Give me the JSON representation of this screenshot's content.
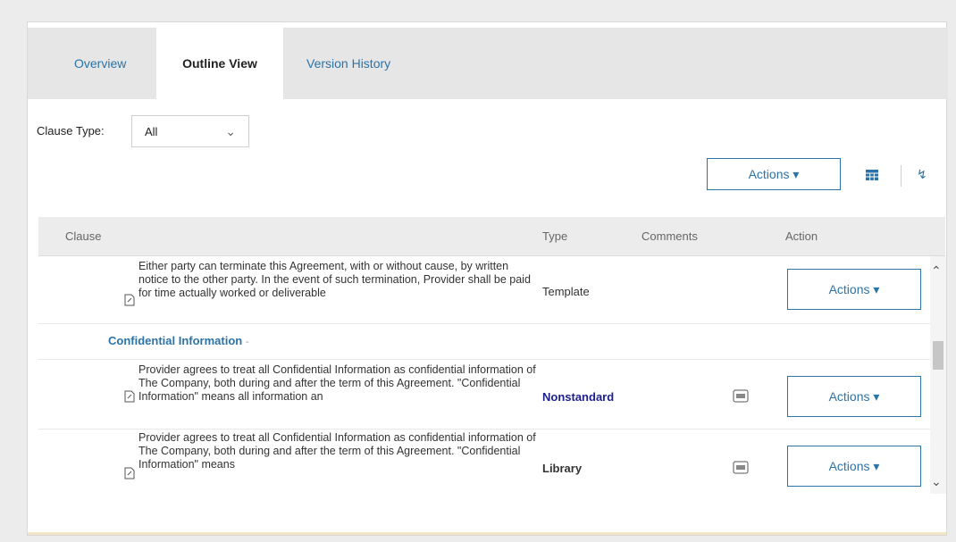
{
  "tabs": [
    {
      "label": "Overview",
      "active": false
    },
    {
      "label": "Outline View",
      "active": true
    },
    {
      "label": "Version History",
      "active": false
    }
  ],
  "filter": {
    "label": "Clause Type:",
    "value": "All",
    "icon": "chevron-down-icon"
  },
  "toolbar": {
    "actions_label": "Actions ▾",
    "grid_icon": "table-grid-icon",
    "expand_icon": "double-chevron-down-icon"
  },
  "table": {
    "headers": {
      "clause": "Clause",
      "type": "Type",
      "comments": "Comments",
      "action": "Action"
    },
    "rows": [
      {
        "text": "Either party can terminate this Agreement, with or without cause, by written notice to the other party. In the event of such termination, Provider shall be paid for time actually worked or deliverable",
        "type": "Template",
        "has_comment": false,
        "action": "Actions ▾"
      },
      {
        "text": "Provider agrees to treat all Confidential Information as confidential information of The Company, both during and after the term of this Agreement. \"Confidential Information\" means all information an",
        "type": "Nonstandard",
        "has_comment": true,
        "action": "Actions ▾"
      },
      {
        "text": "Provider agrees to treat all Confidential Information as confidential information of The Company, both during and after the term of this Agreement. \"Confidential Information\" means",
        "type": "Library",
        "has_comment": true,
        "action": "Actions ▾"
      }
    ],
    "group": {
      "label": "Confidential Information",
      "caret": "-"
    }
  },
  "colors": {
    "accent": "#2c73a8",
    "nonstandard": "#1d1f8a",
    "tabbar": "#e6e6e6"
  }
}
